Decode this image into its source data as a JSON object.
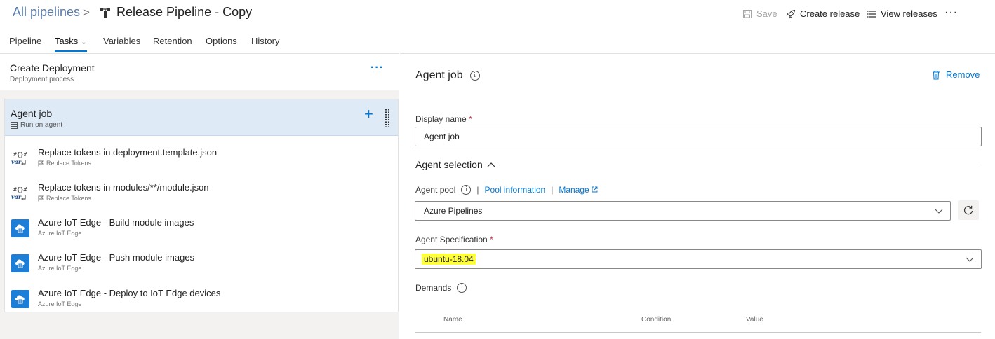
{
  "header": {
    "breadcrumb_link": "All pipelines",
    "breadcrumb_sep": ">",
    "title": "Release Pipeline - Copy",
    "actions": {
      "save": "Save",
      "create_release": "Create release",
      "view_releases": "View releases",
      "more": "···"
    }
  },
  "tabs": [
    {
      "label": "Pipeline"
    },
    {
      "label": "Tasks"
    },
    {
      "label": "Variables"
    },
    {
      "label": "Retention"
    },
    {
      "label": "Options"
    },
    {
      "label": "History"
    }
  ],
  "stage": {
    "title": "Create Deployment",
    "subtitle": "Deployment process",
    "more": "···"
  },
  "agent_job": {
    "name": "Agent job",
    "subtitle": "Run on agent",
    "add": "+"
  },
  "tasks": [
    {
      "name": "Replace tokens in deployment.template.json",
      "sub": "Replace Tokens",
      "icon": "replace-tokens-icon"
    },
    {
      "name": "Replace tokens in modules/**/module.json",
      "sub": "Replace Tokens",
      "icon": "replace-tokens-icon"
    },
    {
      "name": "Azure IoT Edge - Build module images",
      "sub": "Azure IoT Edge",
      "icon": "azure-iot-edge-icon"
    },
    {
      "name": "Azure IoT Edge - Push module images",
      "sub": "Azure IoT Edge",
      "icon": "azure-iot-edge-icon"
    },
    {
      "name": "Azure IoT Edge - Deploy to IoT Edge devices",
      "sub": "Azure IoT Edge",
      "icon": "azure-iot-edge-icon"
    }
  ],
  "detail": {
    "title": "Agent job",
    "remove": "Remove",
    "display_name_label": "Display name",
    "display_name_value": "Agent job",
    "required_mark": "*",
    "agent_selection": "Agent selection",
    "agent_pool_label": "Agent pool",
    "pool_information": "Pool information",
    "manage": "Manage",
    "bar": "|",
    "agent_pool_value": "Azure Pipelines",
    "agent_spec_label": "Agent Specification",
    "agent_spec_value": "ubuntu-18.04",
    "demands_label": "Demands",
    "demands_columns": [
      "Name",
      "Condition",
      "Value"
    ]
  },
  "colors": {
    "accent": "#0078d4",
    "selected_row": "#dfeaf7",
    "highlight": "#ffff3a",
    "required": "#c4314b"
  }
}
